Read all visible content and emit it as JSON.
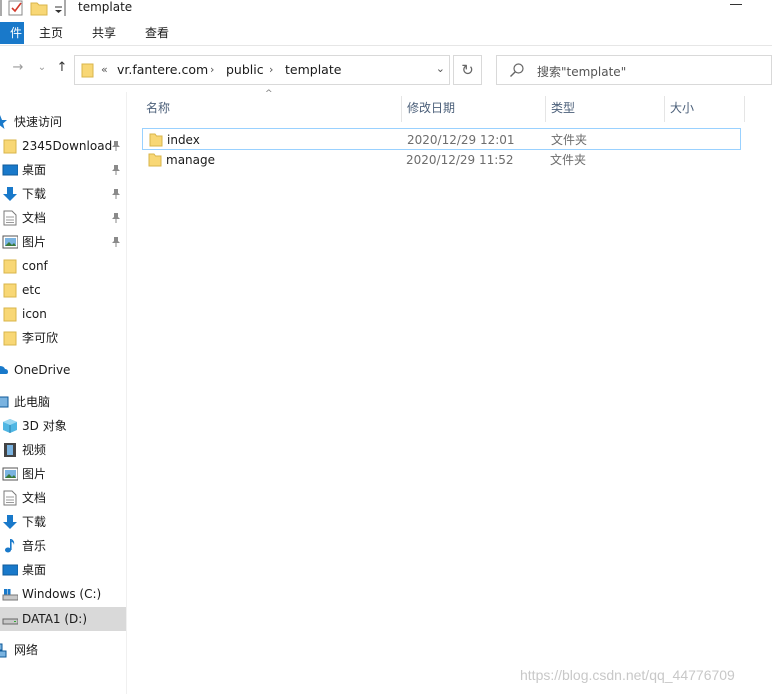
{
  "window": {
    "title": "template"
  },
  "ribbon": {
    "tabs": [
      {
        "label": "件"
      },
      {
        "label": "主页"
      },
      {
        "label": "共享"
      },
      {
        "label": "查看"
      }
    ]
  },
  "address": {
    "prefix": "«",
    "crumbs": [
      "vr.fantere.com",
      "public",
      "template"
    ],
    "search_placeholder": "搜索\"template\""
  },
  "sidebar": {
    "quick_access": "快速访问",
    "pinned": [
      "2345Download",
      "桌面",
      "下载",
      "文档",
      "图片"
    ],
    "folders": [
      "conf",
      "etc",
      "icon",
      "李可欣"
    ],
    "onedrive": "OneDrive",
    "this_pc": "此电脑",
    "pc_items": [
      "3D 对象",
      "视频",
      "图片",
      "文档",
      "下载",
      "音乐",
      "桌面",
      "Windows (C:)",
      "DATA1 (D:)"
    ],
    "network": "网络"
  },
  "columns": {
    "name": "名称",
    "date": "修改日期",
    "type": "类型",
    "size": "大小"
  },
  "files": [
    {
      "name": "index",
      "date": "2020/12/29 12:01",
      "type": "文件夹"
    },
    {
      "name": "manage",
      "date": "2020/12/29 11:52",
      "type": "文件夹"
    }
  ],
  "watermark": "https://blog.csdn.net/qq_44776709",
  "colors": {
    "accent": "#1979ca",
    "selection_border": "#99d1ff",
    "sidebar_selected": "#d9d9d9",
    "folder": "#f8d775"
  }
}
